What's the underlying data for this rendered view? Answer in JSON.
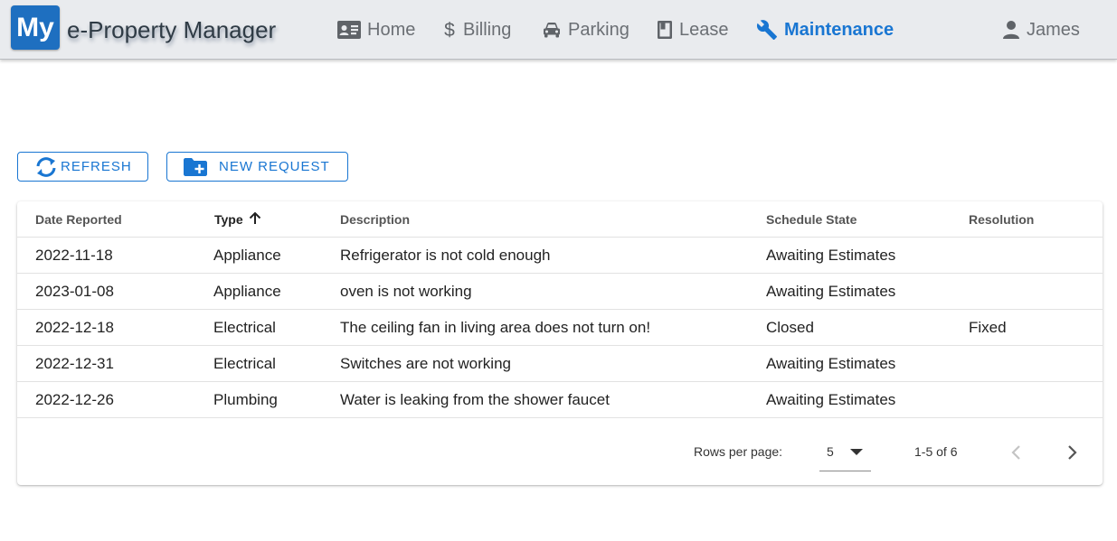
{
  "header": {
    "logo": "My",
    "title": "e-Property Manager",
    "nav": [
      {
        "label": "Home",
        "icon": "id-card-icon",
        "active": false
      },
      {
        "label": "Billing",
        "icon": "dollar-icon",
        "active": false
      },
      {
        "label": "Parking",
        "icon": "car-icon",
        "active": false
      },
      {
        "label": "Lease",
        "icon": "book-icon",
        "active": false
      },
      {
        "label": "Maintenance",
        "icon": "wrench-icon",
        "active": true
      }
    ],
    "user": {
      "label": "James",
      "icon": "person-icon"
    }
  },
  "actions": {
    "refresh_label": "REFRESH",
    "new_request_label": "NEW REQUEST"
  },
  "table": {
    "columns": [
      "Date Reported",
      "Type",
      "Description",
      "Schedule State",
      "Resolution"
    ],
    "sort_column": "Type",
    "sort_direction": "ascending",
    "rows": [
      {
        "date": "2022-11-18",
        "type": "Appliance",
        "description": "Refrigerator is not cold enough",
        "state": "Awaiting Estimates",
        "resolution": ""
      },
      {
        "date": "2023-01-08",
        "type": "Appliance",
        "description": "oven is not working",
        "state": "Awaiting Estimates",
        "resolution": ""
      },
      {
        "date": "2022-12-18",
        "type": "Electrical",
        "description": "The ceiling fan in living area does not turn on!",
        "state": "Closed",
        "resolution": "Fixed"
      },
      {
        "date": "2022-12-31",
        "type": "Electrical",
        "description": "Switches are not working",
        "state": "Awaiting Estimates",
        "resolution": ""
      },
      {
        "date": "2022-12-26",
        "type": "Plumbing",
        "description": "Water is leaking from the shower faucet",
        "state": "Awaiting Estimates",
        "resolution": ""
      }
    ]
  },
  "pagination": {
    "rows_per_page_label": "Rows per page:",
    "rows_per_page_value": "5",
    "range_label": "1-5 of 6"
  },
  "colors": {
    "accent": "#1976d2",
    "appbar": "#e9ebee",
    "logo": "#1e6fc0"
  }
}
